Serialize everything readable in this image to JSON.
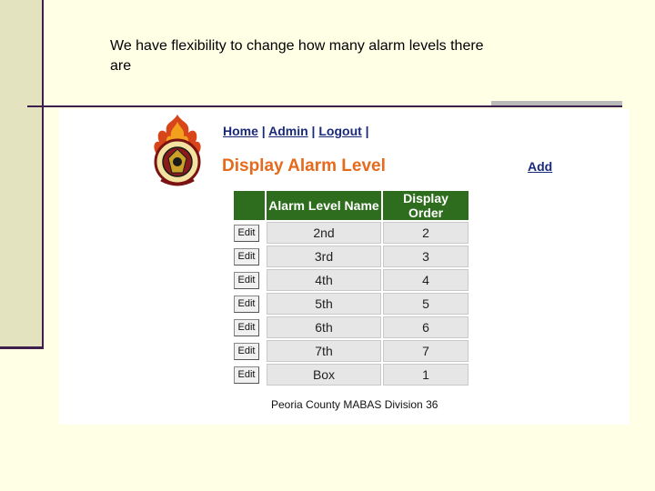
{
  "caption": "We have flexibility to change how many alarm levels there are",
  "nav": {
    "home": "Home",
    "admin": "Admin",
    "logout": "Logout",
    "sep": " | ",
    "trail": " |"
  },
  "page_title": "Display Alarm Level",
  "add_label": "Add",
  "table": {
    "headers": [
      "",
      "Alarm Level Name",
      "Display Order"
    ],
    "edit_label": "Edit",
    "rows": [
      {
        "name": "2nd",
        "order": "2"
      },
      {
        "name": "3rd",
        "order": "3"
      },
      {
        "name": "4th",
        "order": "4"
      },
      {
        "name": "5th",
        "order": "5"
      },
      {
        "name": "6th",
        "order": "6"
      },
      {
        "name": "7th",
        "order": "7"
      },
      {
        "name": "Box",
        "order": "1"
      }
    ]
  },
  "footer": "Peoria County MABAS Division 36",
  "colors": {
    "title_orange": "#e66a1c",
    "header_green": "#2e6d1e",
    "link_blue": "#1a2a7a"
  },
  "logo_icon": "fire-department-emblem-icon"
}
